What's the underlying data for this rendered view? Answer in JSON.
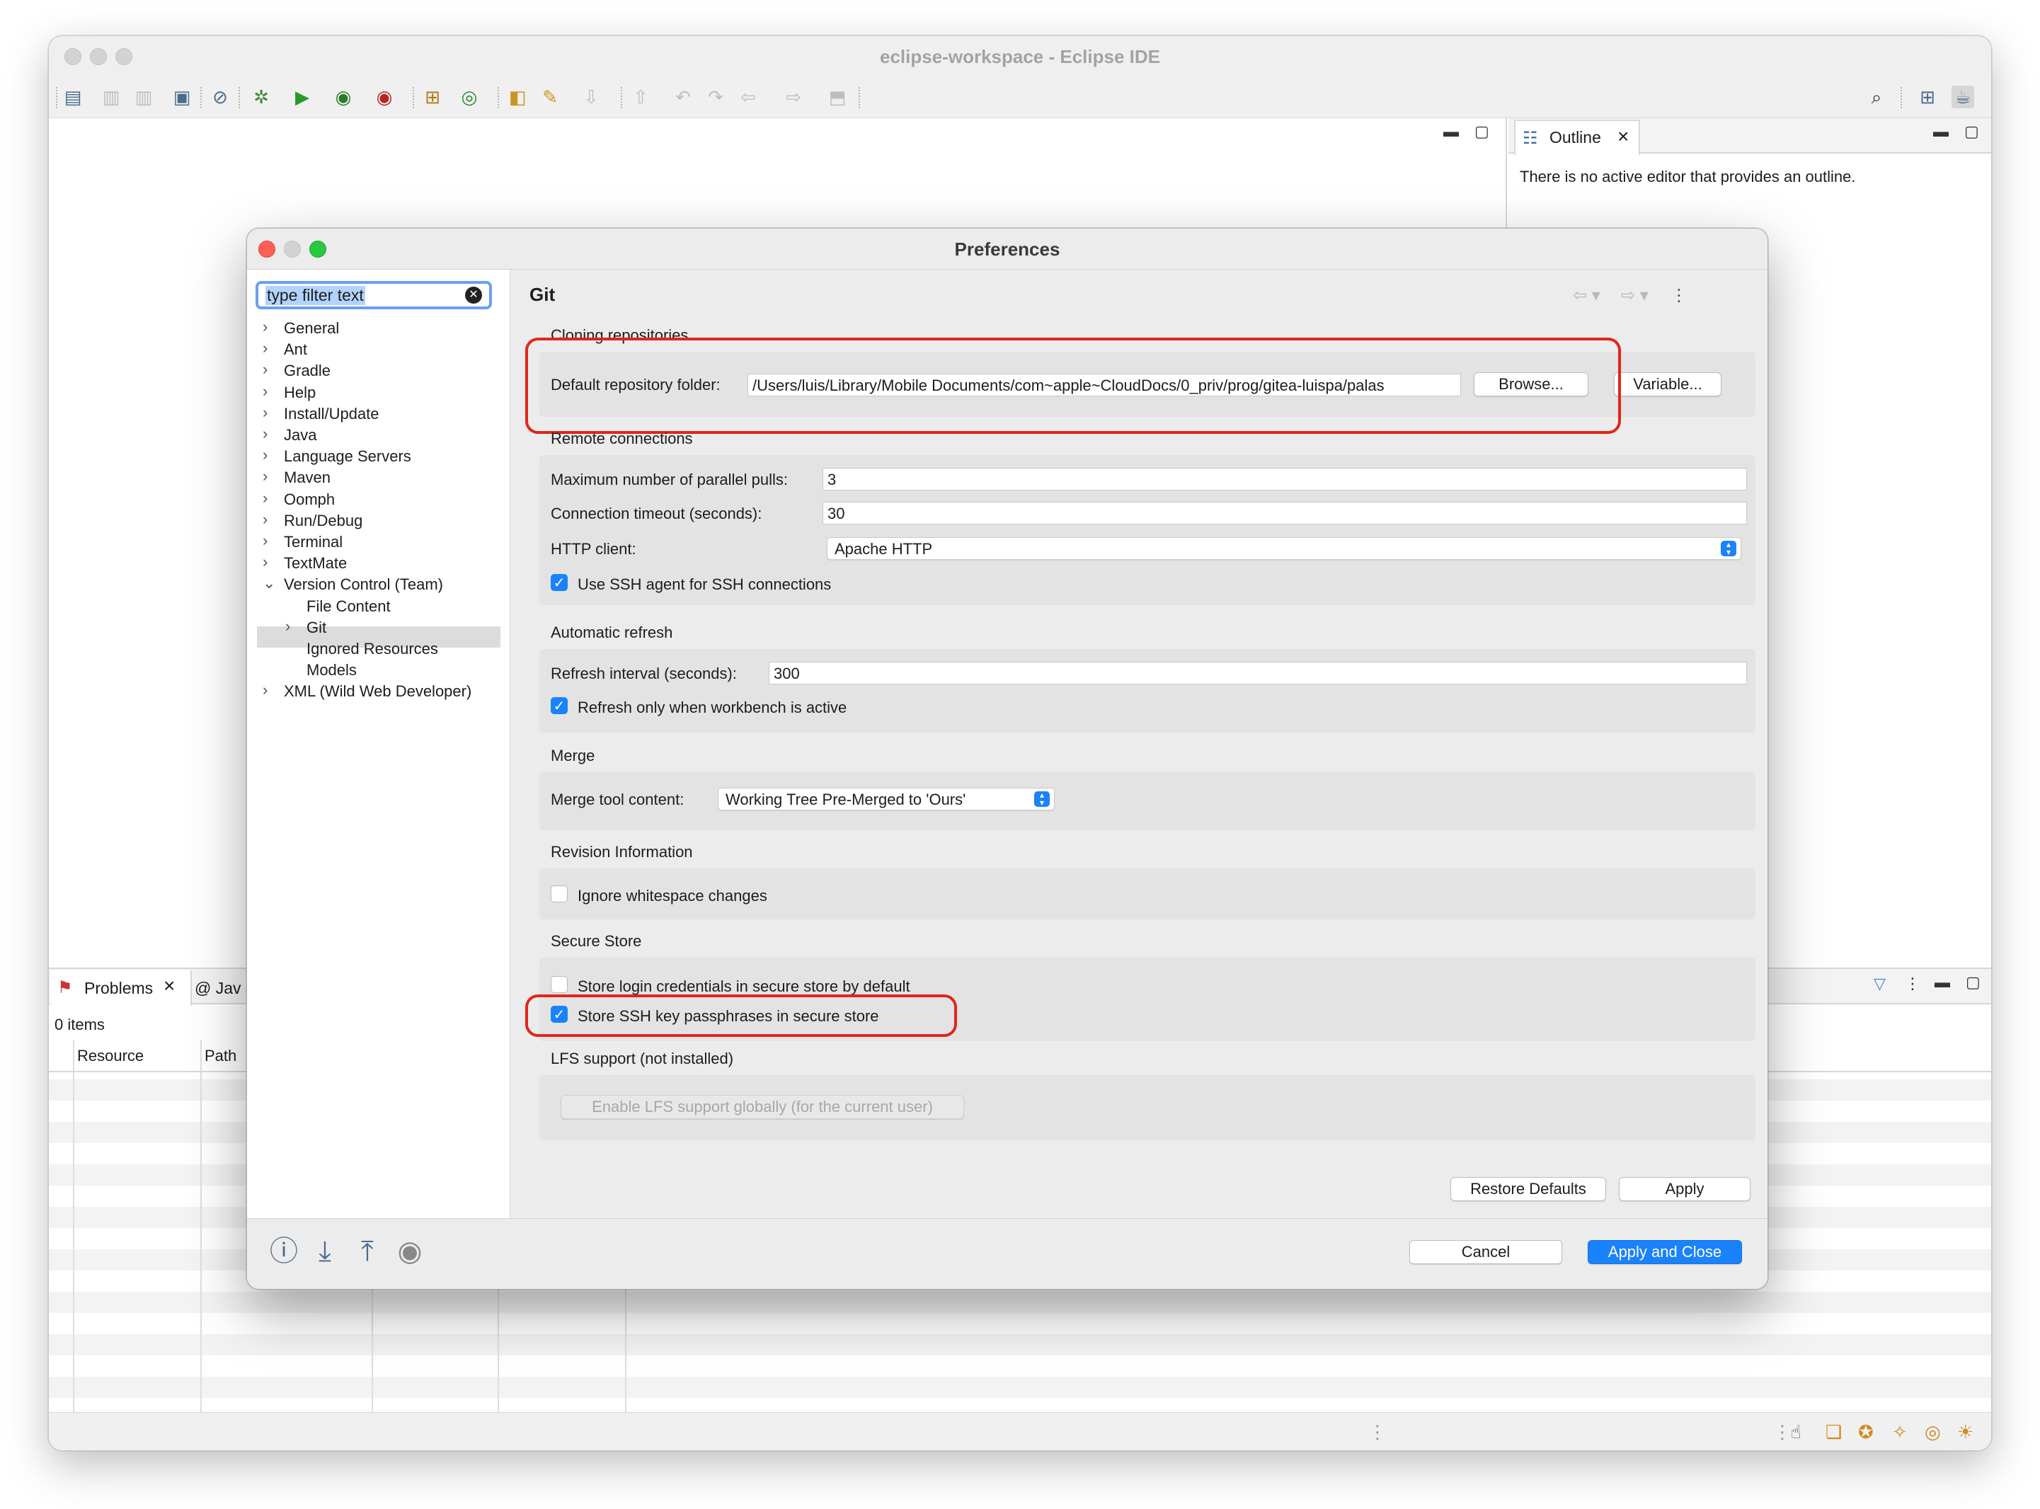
{
  "window": {
    "title": "eclipse-workspace - Eclipse IDE"
  },
  "outline": {
    "tab_label": "Outline",
    "message": "There is no active editor that provides an outline."
  },
  "problems": {
    "tab_label": "Problems",
    "java_tab_label": "Jav",
    "items_count": "0 items",
    "columns": [
      "Resource",
      "Path"
    ]
  },
  "preferences": {
    "title": "Preferences",
    "filter_placeholder": "type filter text",
    "tree": [
      {
        "label": "General",
        "expanded": false,
        "level": 0
      },
      {
        "label": "Ant",
        "expanded": false,
        "level": 0
      },
      {
        "label": "Gradle",
        "expanded": false,
        "level": 0
      },
      {
        "label": "Help",
        "expanded": false,
        "level": 0
      },
      {
        "label": "Install/Update",
        "expanded": false,
        "level": 0
      },
      {
        "label": "Java",
        "expanded": false,
        "level": 0
      },
      {
        "label": "Language Servers",
        "expanded": false,
        "level": 0
      },
      {
        "label": "Maven",
        "expanded": false,
        "level": 0
      },
      {
        "label": "Oomph",
        "expanded": false,
        "level": 0
      },
      {
        "label": "Run/Debug",
        "expanded": false,
        "level": 0
      },
      {
        "label": "Terminal",
        "expanded": false,
        "level": 0
      },
      {
        "label": "TextMate",
        "expanded": false,
        "level": 0
      },
      {
        "label": "Version Control (Team)",
        "expanded": true,
        "level": 0
      },
      {
        "label": "File Content",
        "expanded": null,
        "level": 1
      },
      {
        "label": "Git",
        "expanded": false,
        "level": 1,
        "selected": true
      },
      {
        "label": "Ignored Resources",
        "expanded": null,
        "level": 1
      },
      {
        "label": "Models",
        "expanded": null,
        "level": 1
      },
      {
        "label": "XML (Wild Web Developer)",
        "expanded": false,
        "level": 0
      }
    ],
    "page_title": "Git",
    "cloning": {
      "section": "Cloning repositories",
      "default_folder_label": "Default repository folder:",
      "default_folder_value": "/Users/luis/Library/Mobile Documents/com~apple~CloudDocs/0_priv/prog/gitea-luispa/palas",
      "browse_label": "Browse...",
      "variable_label": "Variable..."
    },
    "remote": {
      "section": "Remote connections",
      "parallel_pulls_label": "Maximum number of parallel pulls:",
      "parallel_pulls_value": "3",
      "timeout_label": "Connection timeout (seconds):",
      "timeout_value": "30",
      "http_client_label": "HTTP client:",
      "http_client_value": "Apache HTTP",
      "ssh_agent_label": "Use SSH agent for SSH connections",
      "ssh_agent_checked": true
    },
    "refresh": {
      "section": "Automatic refresh",
      "interval_label": "Refresh interval (seconds):",
      "interval_value": "300",
      "only_active_label": "Refresh only when workbench is active",
      "only_active_checked": true
    },
    "merge": {
      "section": "Merge",
      "tool_content_label": "Merge tool content:",
      "tool_content_value": "Working Tree Pre-Merged to 'Ours'"
    },
    "revision": {
      "section": "Revision Information",
      "ignore_ws_label": "Ignore whitespace changes",
      "ignore_ws_checked": false
    },
    "secure": {
      "section": "Secure Store",
      "login_label": "Store login credentials in secure store by default",
      "login_checked": false,
      "ssh_pass_label": "Store SSH key passphrases in secure store",
      "ssh_pass_checked": true
    },
    "lfs": {
      "section": "LFS support (not installed)",
      "enable_label": "Enable LFS support globally (for the current user)"
    },
    "restore_defaults_label": "Restore Defaults",
    "apply_label": "Apply",
    "cancel_label": "Cancel",
    "apply_close_label": "Apply and Close"
  },
  "colors": {
    "accent": "#1a82fb",
    "highlight": "#e0261c"
  }
}
